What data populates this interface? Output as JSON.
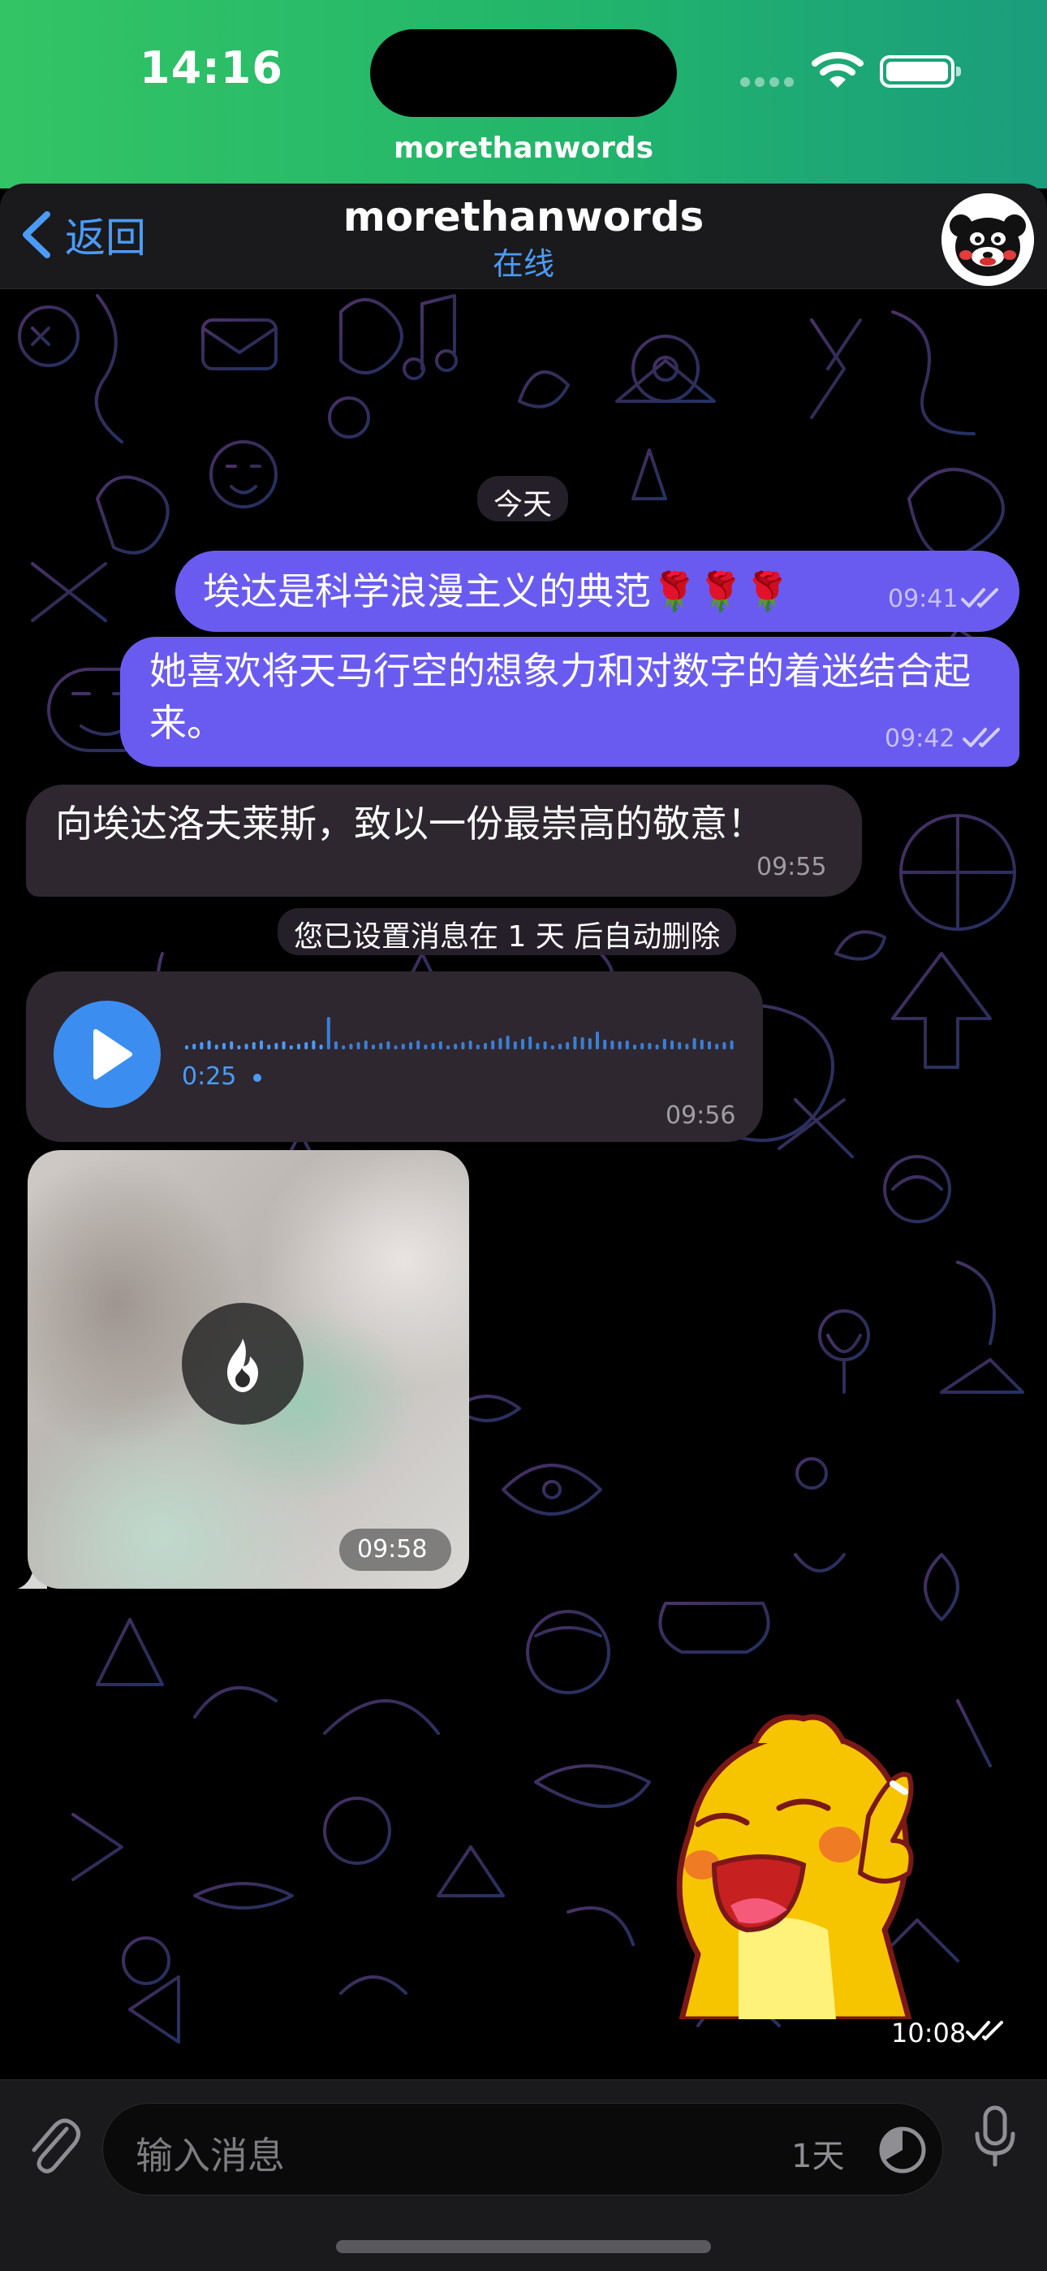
{
  "status_bar": {
    "time": "14:16"
  },
  "call_banner": {
    "name": "morethanwords"
  },
  "header": {
    "back_label": "返回",
    "title": "morethanwords",
    "status": "在线"
  },
  "chat": {
    "date_label": "今天",
    "messages": [
      {
        "type": "text",
        "direction": "out",
        "text": "埃达是科学浪漫主义的典范🌹🌹🌹",
        "time": "09:41",
        "read": true
      },
      {
        "type": "text",
        "direction": "out",
        "text": "她喜欢将天马行空的想象力和对数字的着迷结合起来。",
        "time": "09:42",
        "read": true
      },
      {
        "type": "text",
        "direction": "in",
        "text": "向埃达洛夫莱斯，致以一份最崇高的敬意！",
        "time": "09:55"
      },
      {
        "type": "service",
        "text": "您已设置消息在 1 天 后自动删除"
      },
      {
        "type": "voice",
        "direction": "in",
        "duration": "0:25",
        "time": "09:56",
        "progress": 0.25
      },
      {
        "type": "photo",
        "direction": "in",
        "self_destruct": true,
        "icon": "flame-icon",
        "time": "09:58"
      },
      {
        "type": "sticker",
        "direction": "out",
        "sticker": "yellow-dinosaur-waving",
        "time": "10:08",
        "read": true
      }
    ]
  },
  "input": {
    "placeholder": "输入消息",
    "timer_label": "1天"
  },
  "colors": {
    "status_green": "#33c465",
    "accent_blue": "#4c9bf5",
    "outgoing_bubble": "#6a5bf0",
    "incoming_bubble": "#2e2730",
    "voice_play": "#3b8ef0"
  }
}
